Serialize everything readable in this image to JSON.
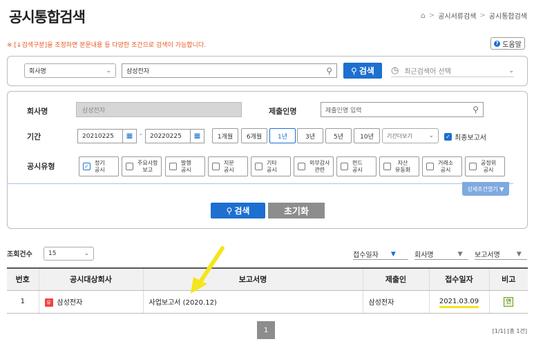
{
  "header": {
    "title": "공시통합검색",
    "breadcrumb": [
      "공시서류검색",
      "공시통합검색"
    ],
    "notice": "※ [↓검색구분]을 조정하면 본문내용 등 다양한 조건으로 검색이 가능합니다.",
    "help_label": "도움말"
  },
  "quick_search": {
    "type_select": "회사명",
    "query_value": "삼성전자",
    "search_label": "검색",
    "recent_placeholder": "최근검색어 선택"
  },
  "detail_search": {
    "company_label": "회사명",
    "company_value": "삼성전자",
    "submitter_label": "제출인명",
    "submitter_placeholder": "제출인명 입력",
    "period_label": "기간",
    "date_from": "20210225",
    "date_to": "20220225",
    "date_sep": "-",
    "period_buttons": [
      "1개월",
      "6개월",
      "1년",
      "3년",
      "5년",
      "10년"
    ],
    "period_selected": "1년",
    "period_dropdown": "기간더보기",
    "final_report_label": "최종보고서",
    "final_report_checked": true,
    "type_label": "공시유형",
    "types": [
      {
        "l1": "정기",
        "l2": "공시",
        "checked": true
      },
      {
        "l1": "주요사항",
        "l2": "보고",
        "checked": false
      },
      {
        "l1": "발행",
        "l2": "공시",
        "checked": false
      },
      {
        "l1": "지분",
        "l2": "공시",
        "checked": false
      },
      {
        "l1": "기타",
        "l2": "공시",
        "checked": false
      },
      {
        "l1": "외부감사",
        "l2": "관련",
        "checked": false
      },
      {
        "l1": "펀드",
        "l2": "공시",
        "checked": false
      },
      {
        "l1": "자산",
        "l2": "유동화",
        "checked": false
      },
      {
        "l1": "거래소",
        "l2": "공시",
        "checked": false
      },
      {
        "l1": "공정위",
        "l2": "공시",
        "checked": false
      }
    ],
    "detail_toggle": "상세조건열기 ▼",
    "search_button": "검색",
    "reset_button": "초기화"
  },
  "results": {
    "count_label": "조회건수",
    "count_value": "15",
    "sort": [
      "접수일자",
      "회사명",
      "보고서명"
    ],
    "columns": [
      "번호",
      "공시대상회사",
      "보고서명",
      "제출인",
      "접수일자",
      "비고"
    ],
    "rows": [
      {
        "no": "1",
        "corp_badge": "유",
        "company": "삼성전자",
        "report": "사업보고서 (2020.12)",
        "submitter": "삼성전자",
        "date": "2021.03.09",
        "note": "연"
      }
    ],
    "page": "1",
    "page_info": "[1/1] [총 1건]"
  },
  "colors": {
    "accent": "#1d6fd0",
    "notice": "#e8561e",
    "highlight": "#f5e51b",
    "annotation_arrow": "#f5e51b"
  },
  "icons": [
    "home-icon",
    "help-icon",
    "search-icon",
    "recent-clock-icon",
    "calendar-icon",
    "chevron-down-icon",
    "check-icon",
    "arrow-annotation-icon"
  ]
}
